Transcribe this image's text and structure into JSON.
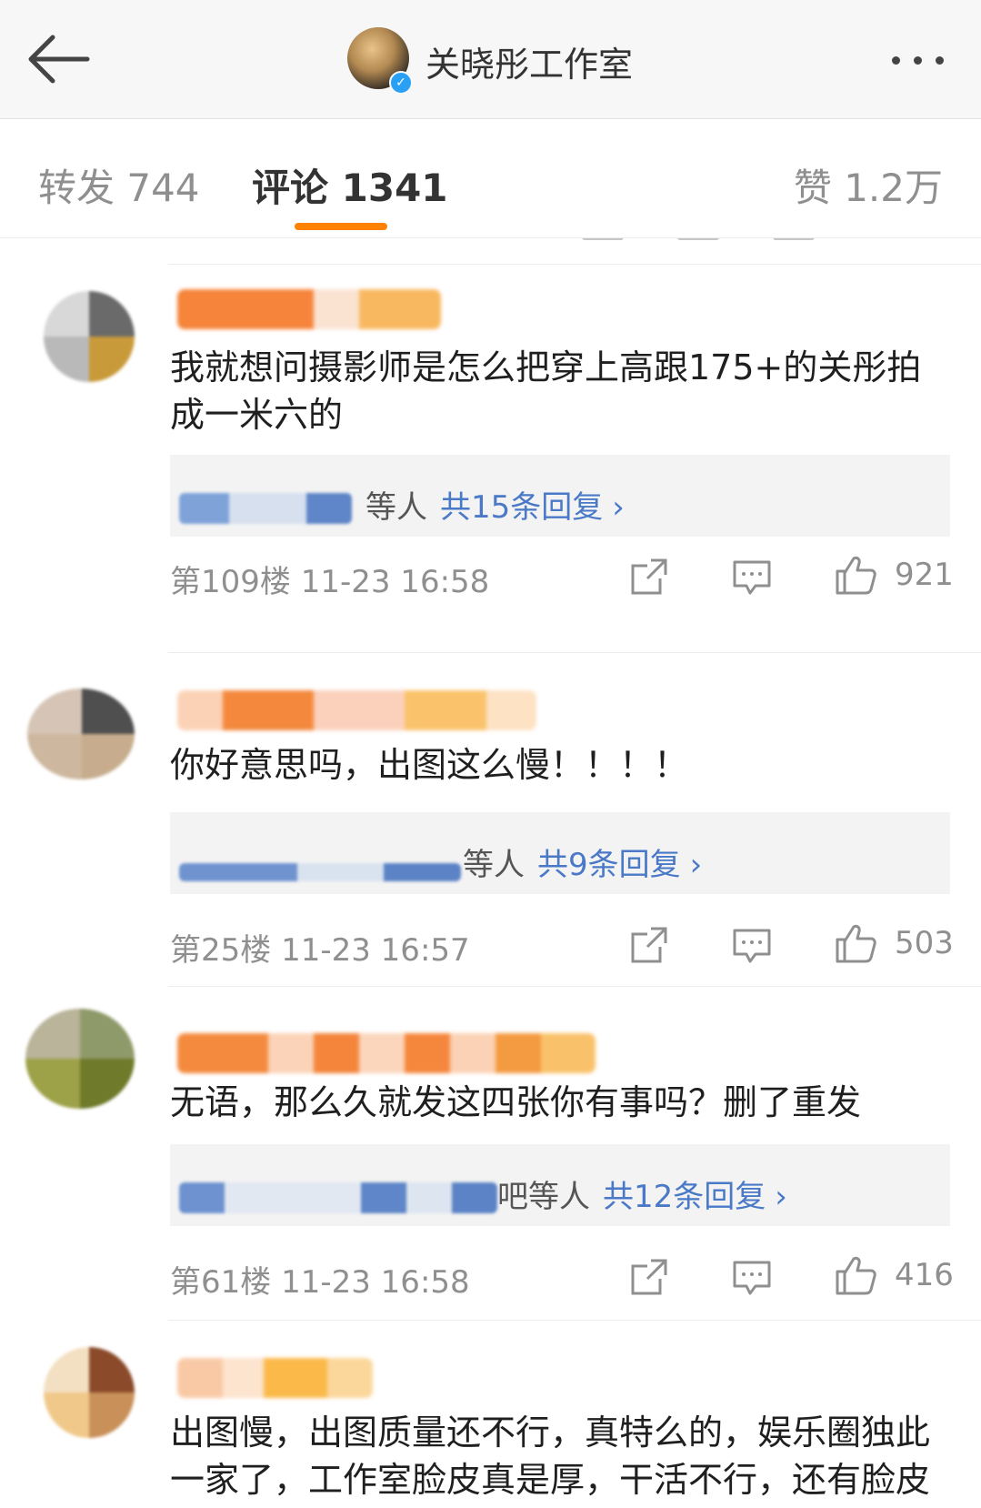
{
  "header": {
    "profile_name": "关晓彤工作室",
    "verified_mark": "✓"
  },
  "tabs": {
    "repost": "转发 744",
    "comments": "评论 1341",
    "likes": "赞 1.2万"
  },
  "icons": {
    "back": "back-arrow-icon",
    "more": "more-dots-icon",
    "share": "share-icon",
    "comment": "comment-icon",
    "like": "like-icon"
  },
  "colors": {
    "accent": "#ff8200",
    "link": "#4a79c7"
  },
  "comments": [
    {
      "text": "我就想问摄影师是怎么把穿上高跟175+的关彤拍成一米六的",
      "reply_suffix": "等人",
      "reply_count": "共15条回复",
      "floor_time": "第109楼 11-23 16:58",
      "likes": "921"
    },
    {
      "text": "你好意思吗，出图这么慢！！！！",
      "reply_suffix": "等人",
      "reply_count": "共9条回复",
      "floor_time": "第25楼 11-23 16:57",
      "likes": "503"
    },
    {
      "text": "无语，那么久就发这四张你有事吗？删了重发",
      "reply_suffix": "吧等人",
      "reply_count": "共12条回复",
      "floor_time": "第61楼 11-23 16:58",
      "likes": "416"
    },
    {
      "text": "出图慢，出图质量还不行，真特么的，娱乐圈独此一家了，工作室脸皮真是厚，干活不行，还有脸皮"
    }
  ],
  "chevron": "›"
}
